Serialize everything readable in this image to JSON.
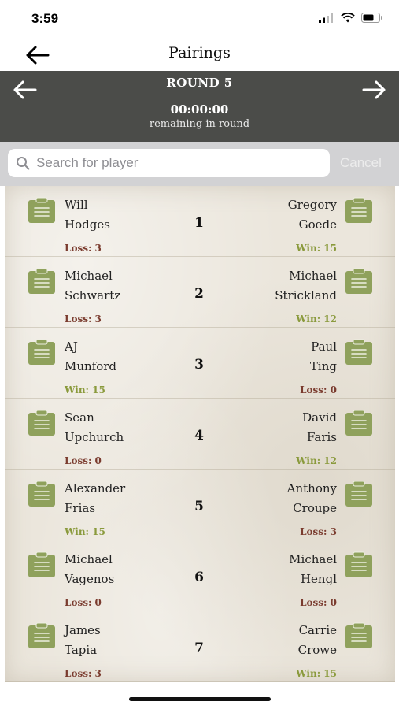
{
  "status_bar": {
    "time": "3:59"
  },
  "nav": {
    "title": "Pairings"
  },
  "round": {
    "label": "ROUND 5",
    "timer": "00:00:00",
    "remaining_text": "remaining in round"
  },
  "search": {
    "placeholder": "Search for player",
    "value": "",
    "cancel_label": "Cancel"
  },
  "colors": {
    "header_bg": "#4b4c49",
    "clipboard_green": "#8fa15c",
    "loss_red": "#7a3b2e",
    "win_green": "#8a9a3c"
  },
  "icons": {
    "back": "arrow-left-icon",
    "prev": "arrow-left-icon",
    "next": "arrow-right-icon",
    "search": "magnifier-icon",
    "clipboard": "clipboard-icon"
  },
  "pairings": [
    {
      "table": "1",
      "left": {
        "first": "Will",
        "last": "Hodges",
        "record": "Loss: 3",
        "result": "loss"
      },
      "right": {
        "first": "Gregory",
        "last": "Goede",
        "record": "Win: 15",
        "result": "win"
      }
    },
    {
      "table": "2",
      "left": {
        "first": "Michael",
        "last": "Schwartz",
        "record": "Loss: 3",
        "result": "loss"
      },
      "right": {
        "first": "Michael",
        "last": "Strickland",
        "record": "Win: 12",
        "result": "win"
      }
    },
    {
      "table": "3",
      "left": {
        "first": "AJ",
        "last": "Munford",
        "record": "Win: 15",
        "result": "win"
      },
      "right": {
        "first": "Paul",
        "last": "Ting",
        "record": "Loss: 0",
        "result": "loss"
      }
    },
    {
      "table": "4",
      "left": {
        "first": "Sean",
        "last": "Upchurch",
        "record": "Loss: 0",
        "result": "loss"
      },
      "right": {
        "first": "David",
        "last": "Faris",
        "record": "Win: 12",
        "result": "win"
      }
    },
    {
      "table": "5",
      "left": {
        "first": "Alexander",
        "last": "Frias",
        "record": "Win: 15",
        "result": "win"
      },
      "right": {
        "first": "Anthony",
        "last": "Croupe",
        "record": "Loss: 3",
        "result": "loss"
      }
    },
    {
      "table": "6",
      "left": {
        "first": "Michael",
        "last": "Vagenos",
        "record": "Loss: 0",
        "result": "loss"
      },
      "right": {
        "first": "Michael",
        "last": "Hengl",
        "record": "Loss: 0",
        "result": "loss"
      }
    },
    {
      "table": "7",
      "left": {
        "first": "James",
        "last": "Tapia",
        "record": "Loss: 3",
        "result": "loss"
      },
      "right": {
        "first": "Carrie",
        "last": "Crowe",
        "record": "Win: 15",
        "result": "win"
      }
    }
  ]
}
